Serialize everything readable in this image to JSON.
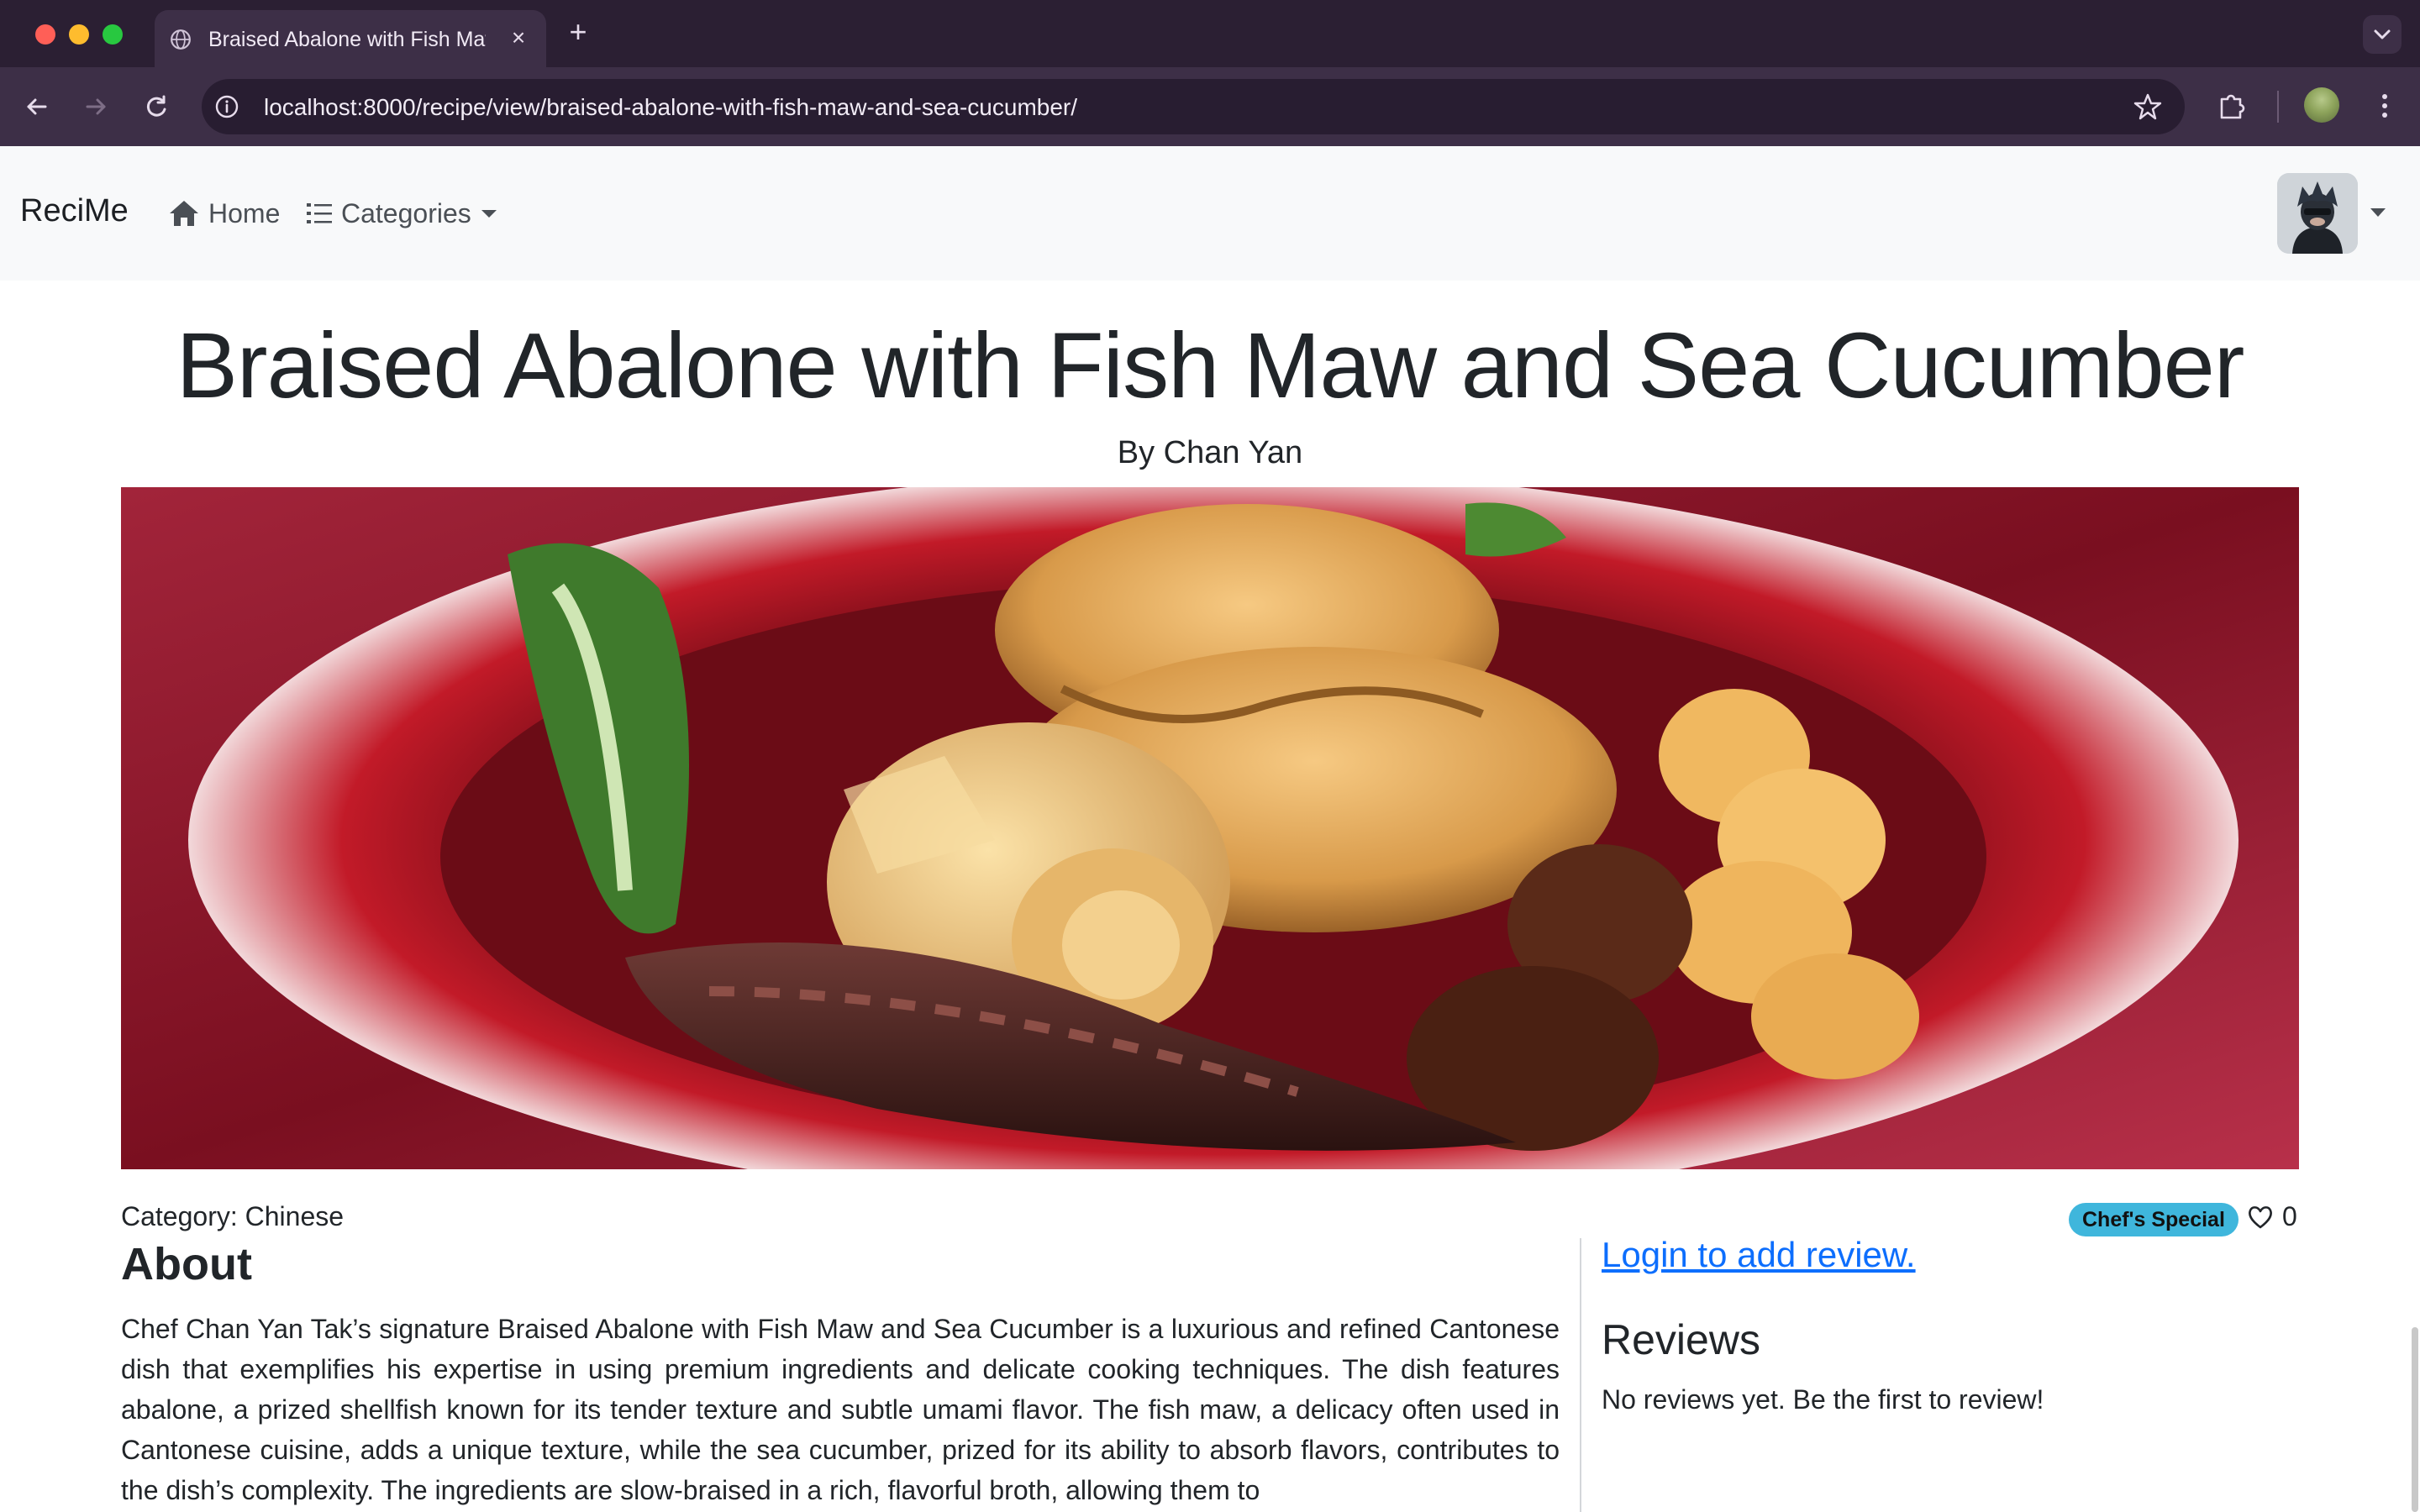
{
  "browser": {
    "tab_title": "Braised Abalone with Fish Maw and Sea Cucumber",
    "url": "localhost:8000/recipe/view/braised-abalone-with-fish-maw-and-sea-cucumber/"
  },
  "navbar": {
    "brand": "ReciMe",
    "home_label": "Home",
    "categories_label": "Categories"
  },
  "recipe": {
    "title": "Braised Abalone with Fish Maw and Sea Cucumber",
    "author": "By Chan Yan",
    "category": "Category: Chinese",
    "badge": "Chef's Special",
    "likes": "0",
    "about_heading": "About",
    "about_text": "Chef Chan Yan Tak’s signature Braised Abalone with Fish Maw and Sea Cucumber is a luxurious and refined Cantonese dish that exemplifies his expertise in using premium ingredients and delicate cooking techniques. The dish features abalone, a prized shellfish known for its tender texture and subtle umami flavor. The fish maw, a delicacy often used in Cantonese cuisine, adds a unique texture, while the sea cucumber, prized for its ability to absorb flavors, contributes to the dish’s complexity. The ingredients are slow-braised in a rich, flavorful broth, allowing them to"
  },
  "reviews": {
    "login_link": "Login to add review.",
    "heading": "Reviews",
    "empty_text": "No reviews yet. Be the first to review!"
  },
  "colors": {
    "accent_link": "#0d6efd",
    "badge_bg": "#3fb6dc",
    "navbar_bg": "#f8f9fa",
    "browser_frame": "#3d2f47"
  }
}
